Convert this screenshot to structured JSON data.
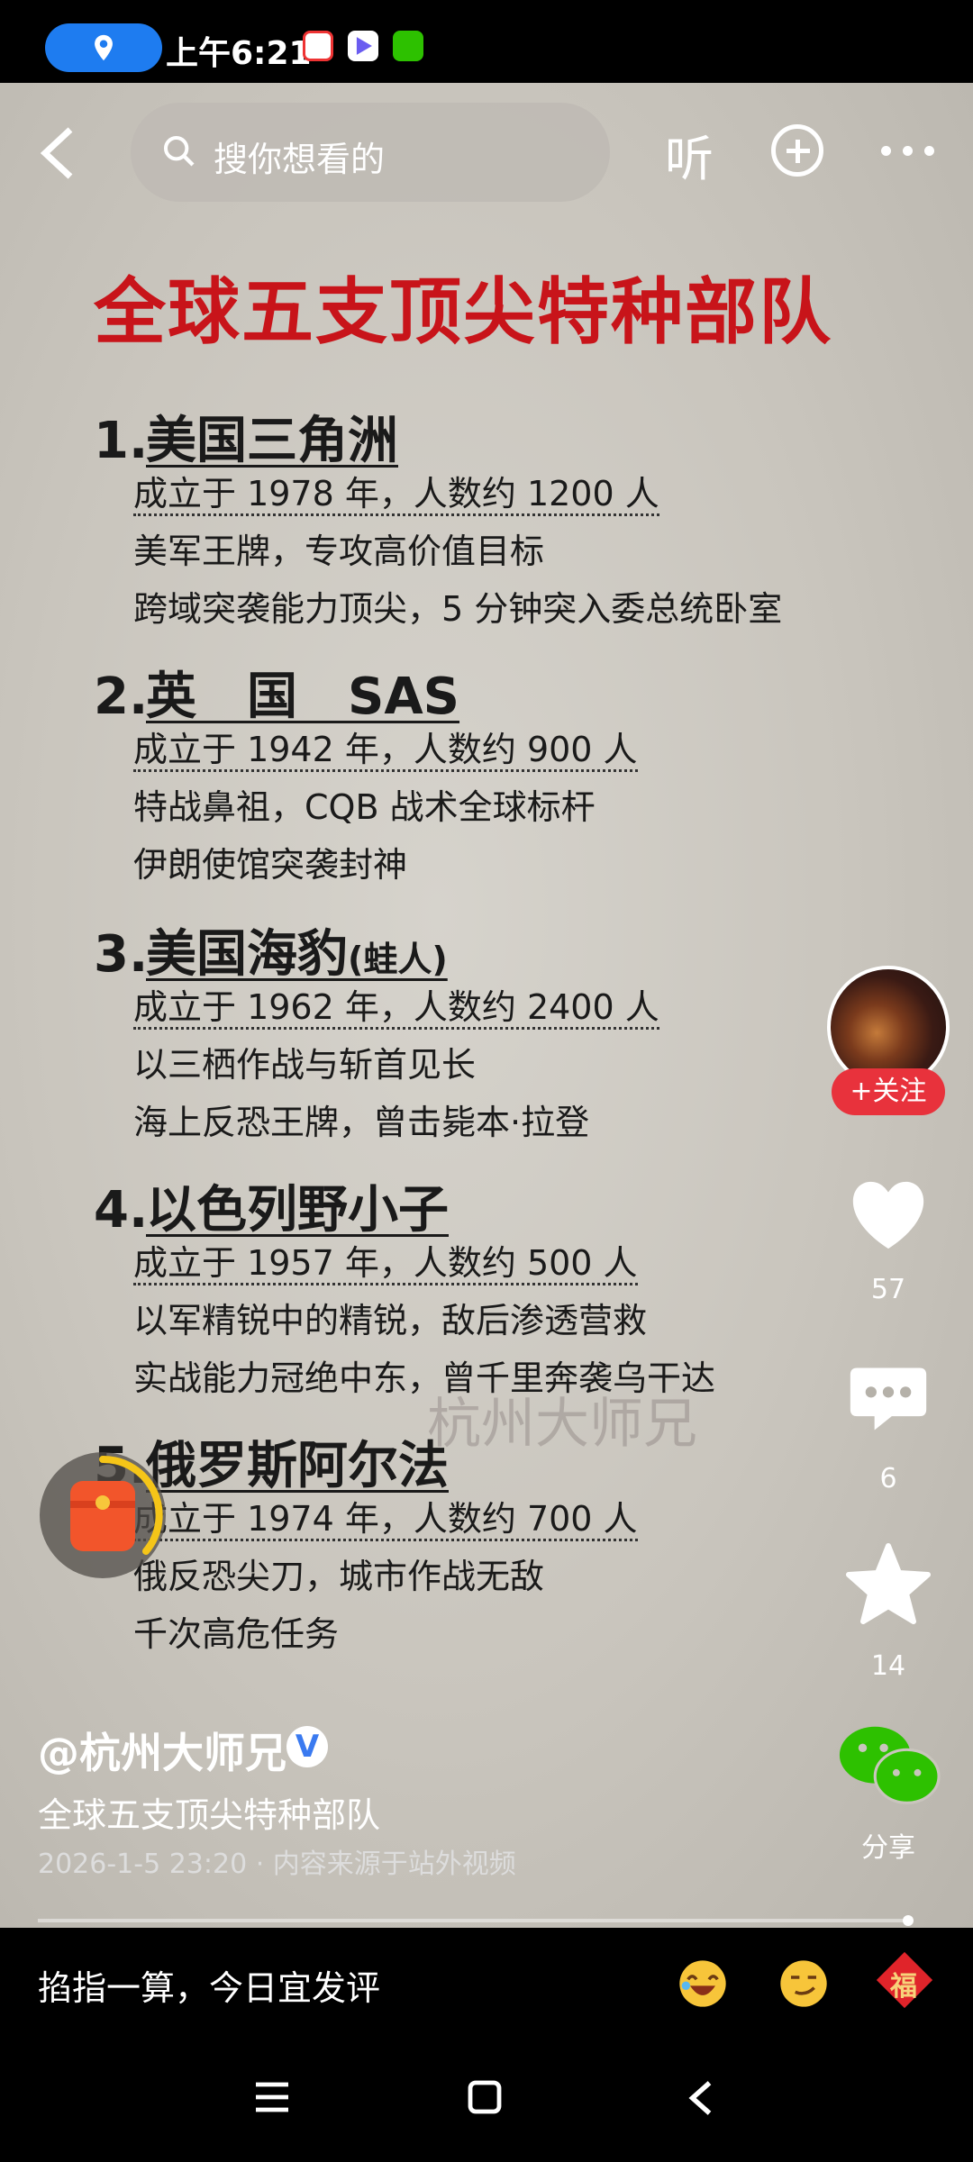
{
  "status": {
    "time": "上午6:21"
  },
  "search": {
    "placeholder": "搜你想看的"
  },
  "topbar": {
    "listen_label": "听"
  },
  "poster": {
    "title": "全球五支顶尖特种部队",
    "sections": [
      {
        "num": "1.",
        "name": "美国三角洲",
        "lines": [
          "成立于 1978 年，人数约 1200 人",
          "美军王牌，专攻高价值目标",
          "跨域突袭能力顶尖，5 分钟突入委总统卧室"
        ]
      },
      {
        "num": "2.",
        "name": "英　国　SAS",
        "lines": [
          "成立于 1942 年，人数约 900 人",
          "特战鼻祖，CQB 战术全球标杆",
          "伊朗使馆突袭封神"
        ]
      },
      {
        "num": "3.",
        "name": "美国海豹",
        "name_suffix": "(蛙人)",
        "lines": [
          "成立于 1962 年，人数约 2400 人",
          "以三栖作战与斩首见长",
          "海上反恐王牌，曾击毙本·拉登"
        ]
      },
      {
        "num": "4.",
        "name": "以色列野小子",
        "lines": [
          "成立于 1957 年，人数约 500 人",
          "以军精锐中的精锐，敌后渗透营救",
          "实战能力冠绝中东，曾千里奔袭乌干达"
        ]
      },
      {
        "num": "5.",
        "name": "俄罗斯阿尔法",
        "lines": [
          "成立于 1974 年，人数约 700 人",
          "俄反恐尖刀，城市作战无敌",
          "千次高危任务"
        ]
      }
    ],
    "watermark": "杭州大师兄"
  },
  "rail": {
    "follow_label": "+关注",
    "likes": "57",
    "comments": "6",
    "favorites": "14",
    "share_label": "分享"
  },
  "caption": {
    "author": "@杭州大师兄",
    "verified_mark": "V",
    "description": "全球五支顶尖特种部队",
    "meta": "2026-1-5 23:20 · 内容来源于站外视频"
  },
  "commentbar": {
    "placeholder": "掐指一算，今日宜发评",
    "fu_label": "福"
  },
  "colors": {
    "accent_red": "#c8141a",
    "follow_red": "#e8323c",
    "wechat_green": "#2dc100",
    "pill_blue": "#1e7cf0"
  }
}
